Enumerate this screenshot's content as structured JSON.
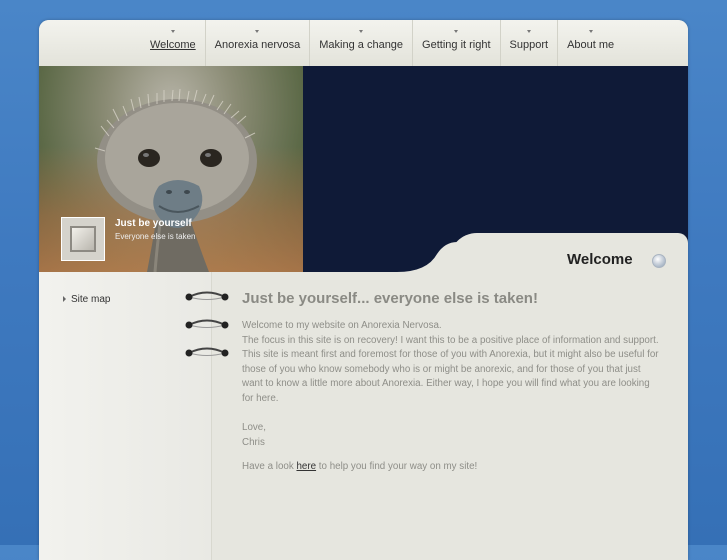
{
  "nav": {
    "items": [
      {
        "label": "Welcome",
        "active": true
      },
      {
        "label": "Anorexia nervosa"
      },
      {
        "label": "Making a change"
      },
      {
        "label": "Getting it right"
      },
      {
        "label": "Support"
      },
      {
        "label": "About me"
      }
    ]
  },
  "header": {
    "caption_title": "Just be yourself",
    "caption_subtitle": "Everyone else is taken",
    "welcome_title": "Welcome"
  },
  "sidebar": {
    "items": [
      {
        "label": "Site map"
      }
    ]
  },
  "content": {
    "heading": "Just be yourself... everyone else is taken!",
    "intro": "Welcome to my website on Anorexia Nervosa.",
    "body": "The focus in this site is on recovery! I want this to be a positive place of information and support. This site is meant first and foremost for those of you with Anorexia, but it might also be useful for those of you who know somebody who is or might be anorexic, and for those of you that just want to know a little more about Anorexia. Either way, I hope you will find what you are looking for here.",
    "signoff": "Love,",
    "signature": "Chris",
    "look_prefix": "Have a look ",
    "look_link": "here",
    "look_suffix": " to help you find your way on my site!"
  },
  "colors": {
    "background": "#3f7ac0",
    "header_dark": "#0f1a37",
    "panel": "#e6e6df",
    "text_muted": "#8e8e88"
  }
}
